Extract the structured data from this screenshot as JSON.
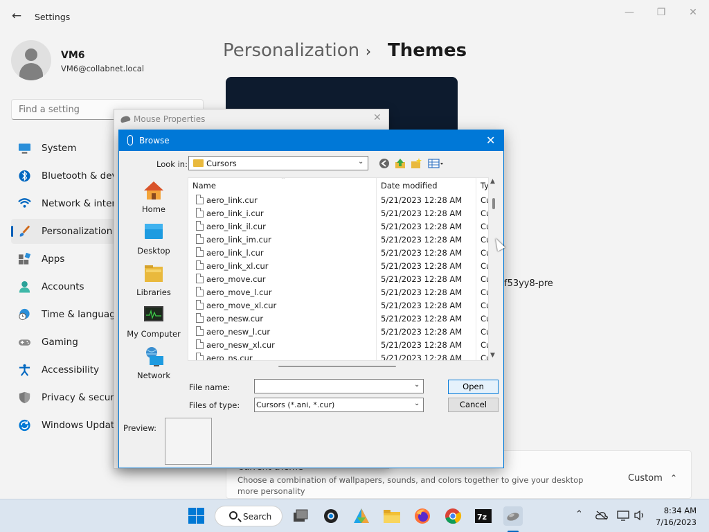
{
  "settings": {
    "app_title": "Settings",
    "user": {
      "name": "VM6",
      "email": "VM6@collabnet.local"
    },
    "search_placeholder": "Find a setting",
    "nav": [
      {
        "label": "System",
        "icon": "monitor-icon"
      },
      {
        "label": "Bluetooth & devi",
        "icon": "bluetooth-icon"
      },
      {
        "label": "Network & intern",
        "icon": "wifi-icon"
      },
      {
        "label": "Personalization",
        "icon": "brush-icon",
        "active": true
      },
      {
        "label": "Apps",
        "icon": "apps-icon"
      },
      {
        "label": "Accounts",
        "icon": "person-icon"
      },
      {
        "label": "Time & language",
        "icon": "clock-globe-icon"
      },
      {
        "label": "Gaming",
        "icon": "gamepad-icon"
      },
      {
        "label": "Accessibility",
        "icon": "accessibility-icon"
      },
      {
        "label": "Privacy & security",
        "icon": "shield-icon"
      },
      {
        "label": "Windows Update",
        "icon": "update-icon"
      }
    ],
    "breadcrumb": {
      "parent": "Personalization",
      "current": "Themes"
    },
    "partial_text": "f53yy8-pre",
    "current_theme": {
      "title": "Current theme",
      "description": "Choose a combination of wallpapers, sounds, and colors together to give your desktop more personality",
      "value": "Custom"
    }
  },
  "mouse_properties": {
    "title": "Mouse Properties"
  },
  "browse": {
    "title": "Browse",
    "look_in_label": "Look in:",
    "look_in_value": "Cursors",
    "places": [
      {
        "label": "Home",
        "icon": "home-icon"
      },
      {
        "label": "Desktop",
        "icon": "desktop-icon"
      },
      {
        "label": "Libraries",
        "icon": "libraries-icon"
      },
      {
        "label": "My Computer",
        "icon": "computer-icon"
      },
      {
        "label": "Network",
        "icon": "network-icon"
      }
    ],
    "columns": {
      "name": "Name",
      "date": "Date modified",
      "type": "Ty"
    },
    "files": [
      {
        "name": "aero_link.cur",
        "date": "5/21/2023 12:28 AM",
        "type": "Cu"
      },
      {
        "name": "aero_link_i.cur",
        "date": "5/21/2023 12:28 AM",
        "type": "Cu"
      },
      {
        "name": "aero_link_il.cur",
        "date": "5/21/2023 12:28 AM",
        "type": "Cu"
      },
      {
        "name": "aero_link_im.cur",
        "date": "5/21/2023 12:28 AM",
        "type": "Cu"
      },
      {
        "name": "aero_link_l.cur",
        "date": "5/21/2023 12:28 AM",
        "type": "Cu"
      },
      {
        "name": "aero_link_xl.cur",
        "date": "5/21/2023 12:28 AM",
        "type": "Cu"
      },
      {
        "name": "aero_move.cur",
        "date": "5/21/2023 12:28 AM",
        "type": "Cu"
      },
      {
        "name": "aero_move_l.cur",
        "date": "5/21/2023 12:28 AM",
        "type": "Cu"
      },
      {
        "name": "aero_move_xl.cur",
        "date": "5/21/2023 12:28 AM",
        "type": "Cu"
      },
      {
        "name": "aero_nesw.cur",
        "date": "5/21/2023 12:28 AM",
        "type": "Cu"
      },
      {
        "name": "aero_nesw_l.cur",
        "date": "5/21/2023 12:28 AM",
        "type": "Cu"
      },
      {
        "name": "aero_nesw_xl.cur",
        "date": "5/21/2023 12:28 AM",
        "type": "Cu"
      },
      {
        "name": "aero_ns.cur",
        "date": "5/21/2023 12:28 AM",
        "type": "Cu"
      }
    ],
    "file_name_label": "File name:",
    "file_name_value": "",
    "files_of_type_label": "Files of type:",
    "files_of_type_value": "Cursors (*.ani, *.cur)",
    "open_label": "Open",
    "cancel_label": "Cancel",
    "preview_label": "Preview:"
  },
  "taskbar": {
    "search_label": "Search",
    "time": "8:34 AM",
    "date": "7/16/2023",
    "apps": [
      "windows-start-icon",
      "task-view-icon",
      "settings-gear-icon",
      "photos-icon",
      "file-explorer-icon",
      "firefox-icon",
      "chrome-icon",
      "7zip-icon",
      "mouse-properties-icon"
    ]
  },
  "colors": {
    "accent": "#0078d7",
    "taskbar": "#dbe5f0"
  }
}
